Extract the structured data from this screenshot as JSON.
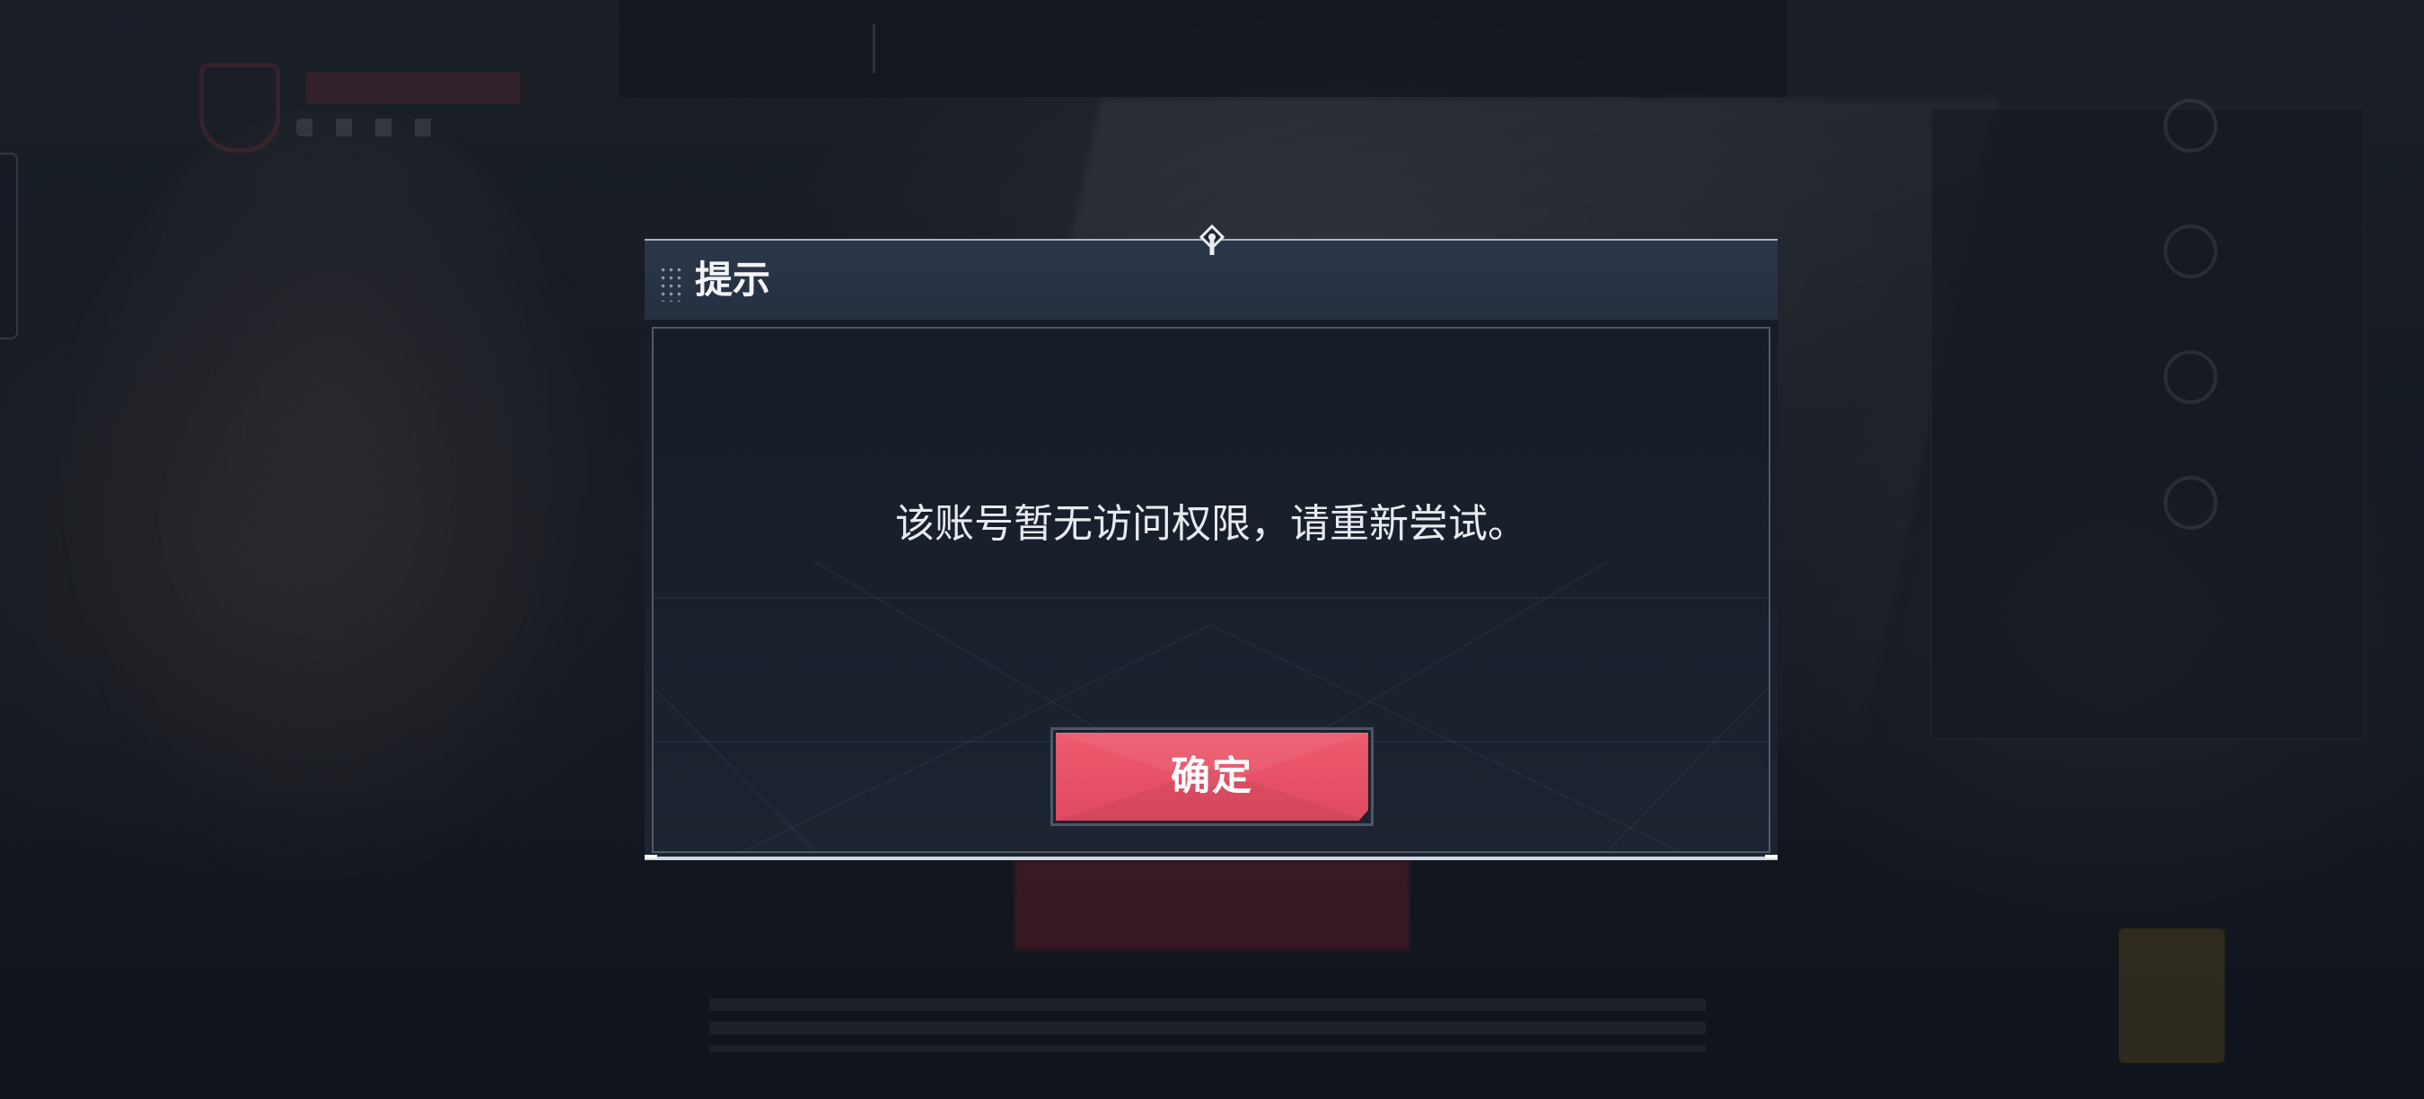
{
  "dialog": {
    "title": "提示",
    "message": "该账号暂无访问权限，请重新尝试。",
    "confirm_label": "确定"
  },
  "icons": {
    "grip": "grip-dots-icon",
    "pin": "pin-marker-icon"
  },
  "colors": {
    "header_bg": "#28344a",
    "body_bg": "#171e2a",
    "confirm_button": "#e8536a",
    "text": "#e8ebef"
  }
}
